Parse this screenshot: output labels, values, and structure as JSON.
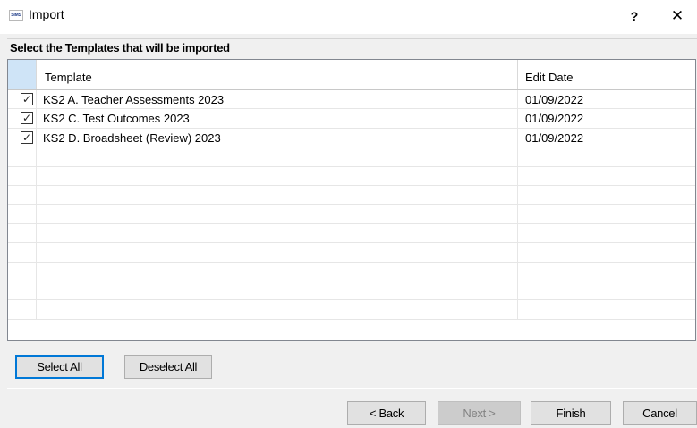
{
  "window": {
    "title": "Import",
    "app_icon_text": "SIMS",
    "help_label": "?",
    "close_label": "✕"
  },
  "section": {
    "heading": "Select the Templates that will be imported"
  },
  "grid": {
    "columns": [
      "Template",
      "Edit Date"
    ],
    "rows": [
      {
        "checked": true,
        "check": "✓",
        "template": "KS2 A. Teacher Assessments 2023",
        "edit_date": "01/09/2022"
      },
      {
        "checked": true,
        "check": "✓",
        "template": "KS2 C. Test Outcomes 2023",
        "edit_date": "01/09/2022"
      },
      {
        "checked": true,
        "check": "✓",
        "template": "KS2 D. Broadsheet (Review) 2023",
        "edit_date": "01/09/2022"
      }
    ]
  },
  "selection_buttons": {
    "select_all": "Select All",
    "deselect_all": "Deselect All"
  },
  "nav_buttons": {
    "back": "< Back",
    "next": "Next >",
    "finish": "Finish",
    "cancel": "Cancel"
  },
  "colors": {
    "focus_border": "#0078d7",
    "header_corner": "#cfe4f7",
    "disabled_text": "#838383"
  }
}
